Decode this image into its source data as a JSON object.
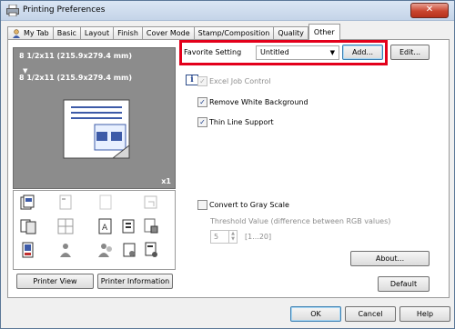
{
  "window": {
    "title": "Printing Preferences",
    "close_label": "✕"
  },
  "tabs": [
    {
      "label": "My Tab"
    },
    {
      "label": "Basic"
    },
    {
      "label": "Layout"
    },
    {
      "label": "Finish"
    },
    {
      "label": "Cover Mode"
    },
    {
      "label": "Stamp/Composition"
    },
    {
      "label": "Quality"
    },
    {
      "label": "Other",
      "active": true
    }
  ],
  "preview": {
    "line1": "8 1/2x11 (215.9x279.4 mm)",
    "arrow": "▼",
    "line2": "8 1/2x11 (215.9x279.4 mm)",
    "count": "x1"
  },
  "buttons": {
    "printer_view": "Printer View",
    "printer_information": "Printer Information",
    "add": "Add...",
    "edit": "Edit...",
    "about": "About...",
    "default": "Default",
    "ok": "OK",
    "cancel": "Cancel",
    "help": "Help"
  },
  "favorite": {
    "label": "Favorite Setting",
    "value": "Untitled"
  },
  "options": {
    "excel_job_control": {
      "label": "Excel Job Control",
      "checked": true,
      "enabled": false
    },
    "remove_white_background": {
      "label": "Remove White Background",
      "checked": true,
      "enabled": true
    },
    "thin_line_support": {
      "label": "Thin Line Support",
      "checked": true,
      "enabled": true
    },
    "convert_to_gray": {
      "label": "Convert to Gray Scale",
      "checked": false,
      "enabled": true
    }
  },
  "threshold": {
    "label": "Threshold Value (difference between RGB values)",
    "value": "5",
    "range": "[1...20]"
  },
  "icons": {
    "info": "i",
    "check": "✓",
    "dropdown_arrow": "▼",
    "spin_up": "▲",
    "spin_down": "▼"
  },
  "colors": {
    "highlight": "#e3001b",
    "preview_bg": "#8c8c8c",
    "page_blue": "#3d5ba8"
  }
}
